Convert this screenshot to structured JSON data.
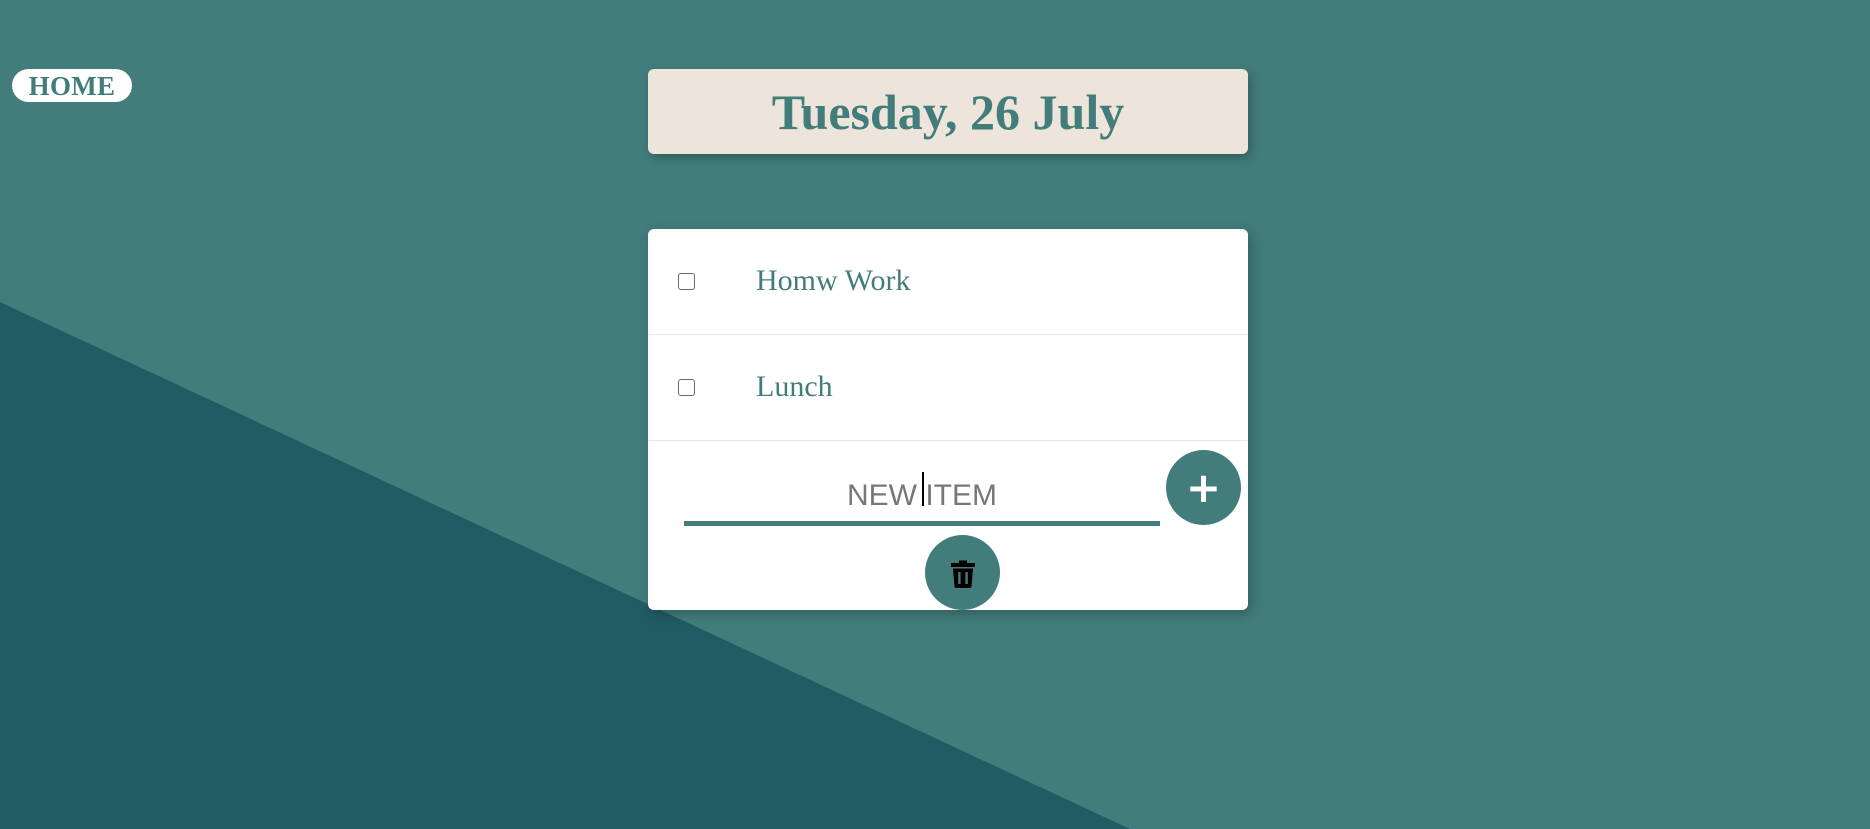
{
  "colors": {
    "background": "#427d7b",
    "background_dark": "#215c64",
    "accent": "#427d7b",
    "date_box": "#ede5db",
    "card": "#ffffff"
  },
  "nav": {
    "home_label": "HOME"
  },
  "header": {
    "date": "Tuesday, 26 July"
  },
  "todo": {
    "items": [
      {
        "label": "Homw Work",
        "checked": false
      },
      {
        "label": "Lunch",
        "checked": false
      }
    ],
    "new_item": {
      "placeholder": "NEW ITEM",
      "value": ""
    },
    "add_label": "+",
    "add_icon": "plus-icon",
    "delete_icon": "trash-icon"
  }
}
